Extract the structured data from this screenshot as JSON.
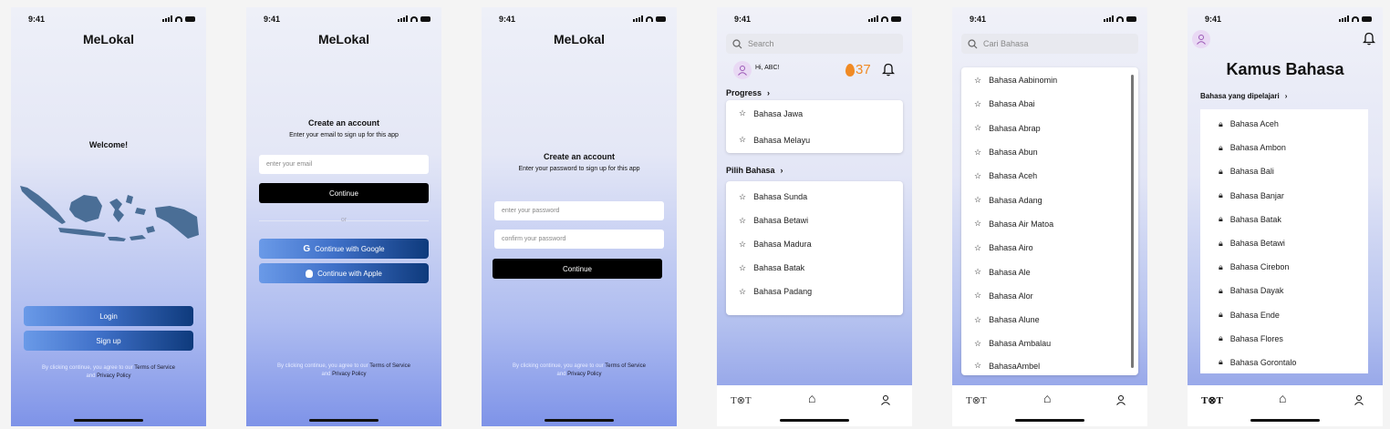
{
  "status_time": "9:41",
  "app_name": "MeLokal",
  "screen1": {
    "welcome": "Welcome!",
    "login_label": "Login",
    "signup_label": "Sign up",
    "terms_prefix": "By clicking continue, you agree to our",
    "terms_link": "Terms of Service",
    "and_text": "and",
    "privacy_link": "Privacy Policy"
  },
  "screen2": {
    "heading": "Create an account",
    "subheading": "Enter your email to sign up for this app",
    "email_placeholder": "enter your email",
    "continue_label": "Continue",
    "or_text": "or",
    "google_label": "Continue with Google",
    "apple_label": "Continue with Apple"
  },
  "screen3": {
    "heading": "Create an account",
    "subheading": "Enter your password to sign up for this app",
    "password_placeholder": "enter your password",
    "confirm_placeholder": "confirm your password",
    "continue_label": "Continue"
  },
  "screen4": {
    "search_placeholder": "Search",
    "greeting": "Hi, ABC!",
    "streak": "37",
    "progress_label": "Progress",
    "progress_items": [
      "Bahasa Jawa",
      "Bahasa Melayu"
    ],
    "pilih_label": "Pilih Bahasa",
    "pilih_items": [
      "Bahasa Sunda",
      "Bahasa Betawi",
      "Bahasa Madura",
      "Bahasa Batak",
      "Bahasa Padang"
    ]
  },
  "screen5": {
    "search_placeholder": "Cari Bahasa",
    "items": [
      "Bahasa Aabinomin",
      "Bahasa Abai",
      "Bahasa Abrap",
      "Bahasa Abun",
      "Bahasa Aceh",
      "Bahasa Adang",
      "Bahasa Air Matoa",
      "Bahasa Airo",
      "Bahasa Ale",
      "Bahasa Alor",
      "Bahasa Alune",
      "Bahasa Ambalau",
      "BahasaAmbel"
    ]
  },
  "screen6": {
    "title": "Kamus Bahasa",
    "section_label": "Bahasa yang dipelajari",
    "items": [
      "Bahasa Aceh",
      "Bahasa Ambon",
      "Bahasa Bali",
      "Bahasa Banjar",
      "Bahasa Batak",
      "Bahasa Betawi",
      "Bahasa Cirebon",
      "Bahasa Dayak",
      "Bahasa Ende",
      "Bahasa Flores",
      "Bahasa Gorontalo"
    ]
  },
  "nav": {
    "logo_text": "T⊗T"
  },
  "colors": {
    "accent_dark": "#0e3a7c",
    "accent_light": "#6a9ae8",
    "map": "#4a6e96",
    "avatar": "#9b59b6",
    "streak": "#f08a24"
  }
}
